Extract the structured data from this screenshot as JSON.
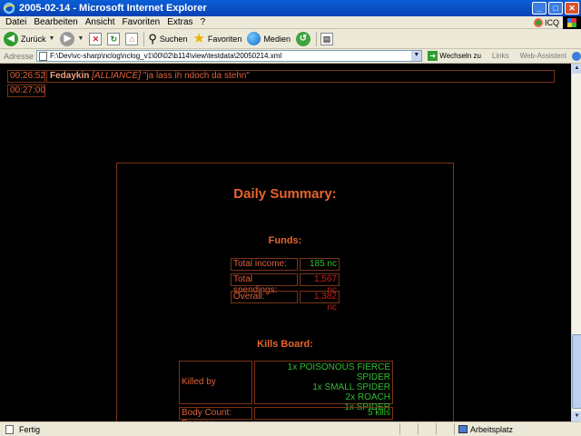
{
  "window": {
    "title": "2005-02-14 - Microsoft Internet Explorer"
  },
  "menu": [
    "Datei",
    "Bearbeiten",
    "Ansicht",
    "Favoriten",
    "Extras",
    "?"
  ],
  "menu_extra": {
    "icq_label": "ICQ"
  },
  "toolbar": {
    "back": "Zurück",
    "search": "Suchen",
    "favorites": "Favoriten",
    "media": "Medien"
  },
  "address": {
    "label": "Adresse",
    "value": "F:\\Dev\\vc-sharp\\nclog\\nclog_v1\\00\\02\\b114\\view\\testdata\\20050214.xml",
    "go": "Wechseln zu",
    "links": "Links",
    "web_assistant": "Web-Assistent"
  },
  "log": [
    {
      "time": "00:26:52",
      "name": "Fedaykin",
      "clan": "[ALLIANCE]",
      "text": "\"ja lass ih ndoch da stehn\""
    },
    {
      "time": "00:27:00"
    }
  ],
  "summary": {
    "title": "Daily Summary:",
    "funds": {
      "heading": "Funds:",
      "total_income_label": "Total income:",
      "total_income": "185 nc",
      "total_spendings_label": "Total spendings:",
      "total_spendings": "1,567 nc",
      "overall_label": "Overall:",
      "overall": "1,382 nc"
    },
    "kills": {
      "heading": "Kills Board:",
      "species_label": "Killed by Species:",
      "species": [
        "1x POISONOUS FIERCE SPIDER",
        "1x SMALL SPIDER",
        "2x ROACH",
        "1x SPIDER"
      ],
      "body_count_label": "Body Count:",
      "body_count": "5 kills"
    }
  },
  "status": {
    "left": "Fertig",
    "right": "Arbeitsplatz"
  },
  "colors": {
    "accent_orange": "#e8642c",
    "positive_green": "#2fbf2f",
    "negative_red": "#c41e1e",
    "border_brown": "#7a3418"
  }
}
